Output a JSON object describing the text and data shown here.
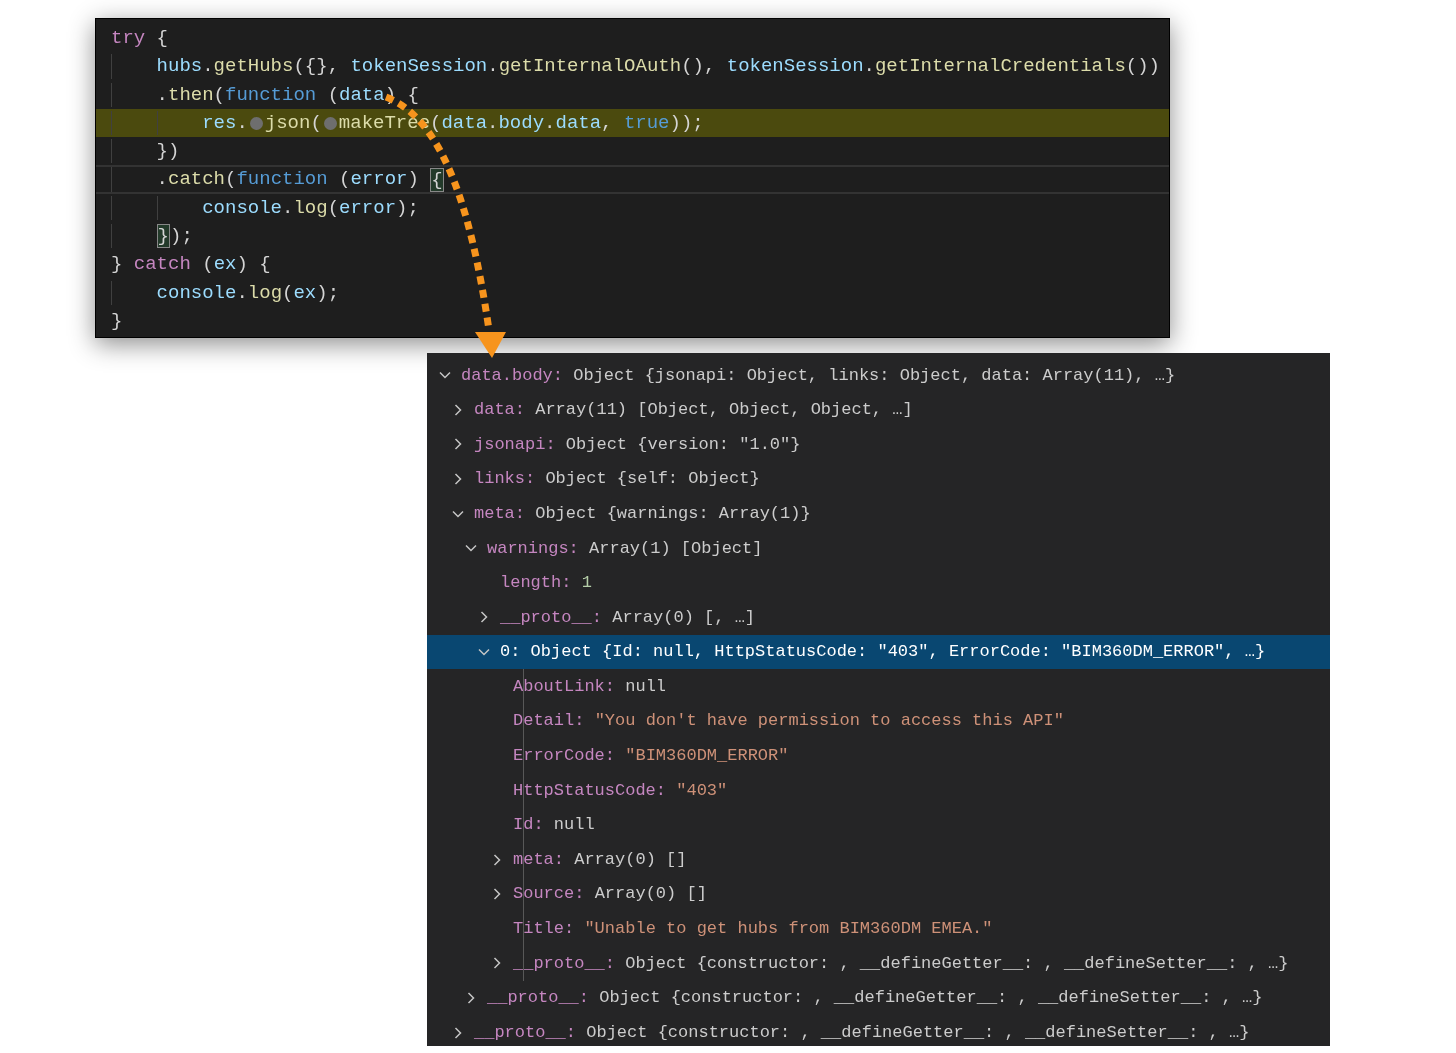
{
  "editor": {
    "lines": [
      {
        "highlighted": false,
        "focused": false,
        "tokens": [
          {
            "kind": "keyword",
            "text": "try"
          },
          {
            "kind": "plain",
            "text": " {"
          }
        ],
        "children": [
          {
            "highlighted": false,
            "focused": false,
            "tokens": [
              {
                "kind": "variable",
                "text": "hubs"
              },
              {
                "kind": "plain",
                "text": "."
              },
              {
                "kind": "function",
                "text": "getHubs"
              },
              {
                "kind": "plain",
                "text": "({}, "
              },
              {
                "kind": "variable",
                "text": "tokenSession"
              },
              {
                "kind": "plain",
                "text": "."
              },
              {
                "kind": "function",
                "text": "getInternalOAuth"
              },
              {
                "kind": "plain",
                "text": "(), "
              },
              {
                "kind": "variable",
                "text": "tokenSession"
              },
              {
                "kind": "plain",
                "text": "."
              },
              {
                "kind": "function",
                "text": "getInternalCredentials"
              },
              {
                "kind": "plain",
                "text": "())"
              }
            ]
          },
          {
            "highlighted": false,
            "focused": false,
            "tokens": [
              {
                "kind": "plain",
                "text": "."
              },
              {
                "kind": "function",
                "text": "then"
              },
              {
                "kind": "plain",
                "text": "("
              },
              {
                "kind": "storage",
                "text": "function"
              },
              {
                "kind": "plain",
                "text": " ("
              },
              {
                "kind": "variable",
                "text": "data"
              },
              {
                "kind": "plain",
                "text": ") {"
              }
            ],
            "children": [
              {
                "highlighted": true,
                "focused": false,
                "tokens": [
                  {
                    "kind": "variable",
                    "text": "res"
                  },
                  {
                    "kind": "plain",
                    "text": "."
                  },
                  {
                    "kind": "breakpoint"
                  },
                  {
                    "kind": "function",
                    "text": "json"
                  },
                  {
                    "kind": "plain",
                    "text": "("
                  },
                  {
                    "kind": "breakpoint"
                  },
                  {
                    "kind": "function",
                    "text": "makeTree"
                  },
                  {
                    "kind": "plain",
                    "text": "("
                  },
                  {
                    "kind": "variable",
                    "text": "data"
                  },
                  {
                    "kind": "plain",
                    "text": "."
                  },
                  {
                    "kind": "variable",
                    "text": "body"
                  },
                  {
                    "kind": "plain",
                    "text": "."
                  },
                  {
                    "kind": "variable",
                    "text": "data"
                  },
                  {
                    "kind": "plain",
                    "text": ", "
                  },
                  {
                    "kind": "storage",
                    "text": "true"
                  },
                  {
                    "kind": "plain",
                    "text": "));"
                  }
                ]
              }
            ]
          },
          {
            "highlighted": false,
            "focused": false,
            "tokens": [
              {
                "kind": "plain",
                "text": "})"
              }
            ]
          },
          {
            "highlighted": false,
            "focused": true,
            "tokens": [
              {
                "kind": "plain",
                "text": "."
              },
              {
                "kind": "function",
                "text": "catch"
              },
              {
                "kind": "plain",
                "text": "("
              },
              {
                "kind": "storage",
                "text": "function"
              },
              {
                "kind": "plain",
                "text": " ("
              },
              {
                "kind": "variable",
                "text": "error"
              },
              {
                "kind": "plain",
                "text": ") "
              },
              {
                "kind": "bracket",
                "text": "{"
              }
            ],
            "children": [
              {
                "highlighted": false,
                "focused": false,
                "tokens": [
                  {
                    "kind": "variable",
                    "text": "console"
                  },
                  {
                    "kind": "plain",
                    "text": "."
                  },
                  {
                    "kind": "function",
                    "text": "log"
                  },
                  {
                    "kind": "plain",
                    "text": "("
                  },
                  {
                    "kind": "variable",
                    "text": "error"
                  },
                  {
                    "kind": "plain",
                    "text": ");"
                  }
                ]
              }
            ]
          },
          {
            "highlighted": false,
            "focused": false,
            "tokens": [
              {
                "kind": "bracket",
                "text": "}"
              },
              {
                "kind": "plain",
                "text": ");"
              }
            ]
          }
        ]
      },
      {
        "highlighted": false,
        "focused": false,
        "tokens": [
          {
            "kind": "plain",
            "text": "} "
          },
          {
            "kind": "keyword",
            "text": "catch"
          },
          {
            "kind": "plain",
            "text": " ("
          },
          {
            "kind": "variable",
            "text": "ex"
          },
          {
            "kind": "plain",
            "text": ") {"
          }
        ],
        "children": [
          {
            "highlighted": false,
            "focused": false,
            "tokens": [
              {
                "kind": "variable",
                "text": "console"
              },
              {
                "kind": "plain",
                "text": "."
              },
              {
                "kind": "function",
                "text": "log"
              },
              {
                "kind": "plain",
                "text": "("
              },
              {
                "kind": "variable",
                "text": "ex"
              },
              {
                "kind": "plain",
                "text": ");"
              }
            ]
          }
        ]
      },
      {
        "highlighted": false,
        "focused": false,
        "tokens": [
          {
            "kind": "plain",
            "text": "}"
          }
        ]
      }
    ]
  },
  "variables": {
    "tree": [
      {
        "key": "data.body:",
        "value": "Object {jsonapi: Object, links: Object, data: Array(11), …}",
        "kind": "preview",
        "expandable": true,
        "expanded": true,
        "selected": false,
        "children": [
          {
            "key": "data:",
            "value": "Array(11) [Object, Object, Object, …]",
            "kind": "preview",
            "expandable": true,
            "expanded": false,
            "selected": false
          },
          {
            "key": "jsonapi:",
            "value": "Object {version: \"1.0\"}",
            "kind": "preview",
            "expandable": true,
            "expanded": false,
            "selected": false
          },
          {
            "key": "links:",
            "value": "Object {self: Object}",
            "kind": "preview",
            "expandable": true,
            "expanded": false,
            "selected": false
          },
          {
            "key": "meta:",
            "value": "Object {warnings: Array(1)}",
            "kind": "preview",
            "expandable": true,
            "expanded": true,
            "selected": false,
            "children": [
              {
                "key": "warnings:",
                "value": "Array(1) [Object]",
                "kind": "preview",
                "expandable": true,
                "expanded": true,
                "selected": false,
                "children": [
                  {
                    "key": "length:",
                    "value": "1",
                    "kind": "number",
                    "expandable": false,
                    "selected": false
                  },
                  {
                    "key": "__proto__:",
                    "value": "Array(0) [, …]",
                    "kind": "preview",
                    "expandable": true,
                    "expanded": false,
                    "selected": false
                  },
                  {
                    "key": "0:",
                    "value": "Object {Id: null, HttpStatusCode: \"403\", ErrorCode: \"BIM360DM_ERROR\", …}",
                    "kind": "preview",
                    "expandable": true,
                    "expanded": true,
                    "selected": true,
                    "children": [
                      {
                        "key": "AboutLink:",
                        "value": "null",
                        "kind": "preview",
                        "expandable": false,
                        "selected": false
                      },
                      {
                        "key": "Detail:",
                        "value": "\"You don't have permission to access this API\"",
                        "kind": "string",
                        "expandable": false,
                        "selected": false
                      },
                      {
                        "key": "ErrorCode:",
                        "value": "\"BIM360DM_ERROR\"",
                        "kind": "string",
                        "expandable": false,
                        "selected": false
                      },
                      {
                        "key": "HttpStatusCode:",
                        "value": "\"403\"",
                        "kind": "string",
                        "expandable": false,
                        "selected": false
                      },
                      {
                        "key": "Id:",
                        "value": "null",
                        "kind": "preview",
                        "expandable": false,
                        "selected": false
                      },
                      {
                        "key": "meta:",
                        "value": "Array(0) []",
                        "kind": "preview",
                        "expandable": true,
                        "expanded": false,
                        "selected": false
                      },
                      {
                        "key": "Source:",
                        "value": "Array(0) []",
                        "kind": "preview",
                        "expandable": true,
                        "expanded": false,
                        "selected": false
                      },
                      {
                        "key": "Title:",
                        "value": "\"Unable to get hubs from BIM360DM EMEA.\"",
                        "kind": "string",
                        "expandable": false,
                        "selected": false
                      },
                      {
                        "key": "__proto__:",
                        "value": "Object {constructor: , __defineGetter__: , __defineSetter__: , …}",
                        "kind": "preview",
                        "expandable": true,
                        "expanded": false,
                        "selected": false
                      }
                    ]
                  }
                ]
              },
              {
                "key": "__proto__:",
                "value": "Object {constructor: , __defineGetter__: , __defineSetter__: , …}",
                "kind": "preview",
                "expandable": true,
                "expanded": false,
                "selected": false
              }
            ]
          },
          {
            "key": "__proto__:",
            "value": "Object {constructor: , __defineGetter__: , __defineSetter__: , …}",
            "kind": "preview",
            "expandable": true,
            "expanded": false,
            "selected": false
          }
        ]
      }
    ]
  }
}
